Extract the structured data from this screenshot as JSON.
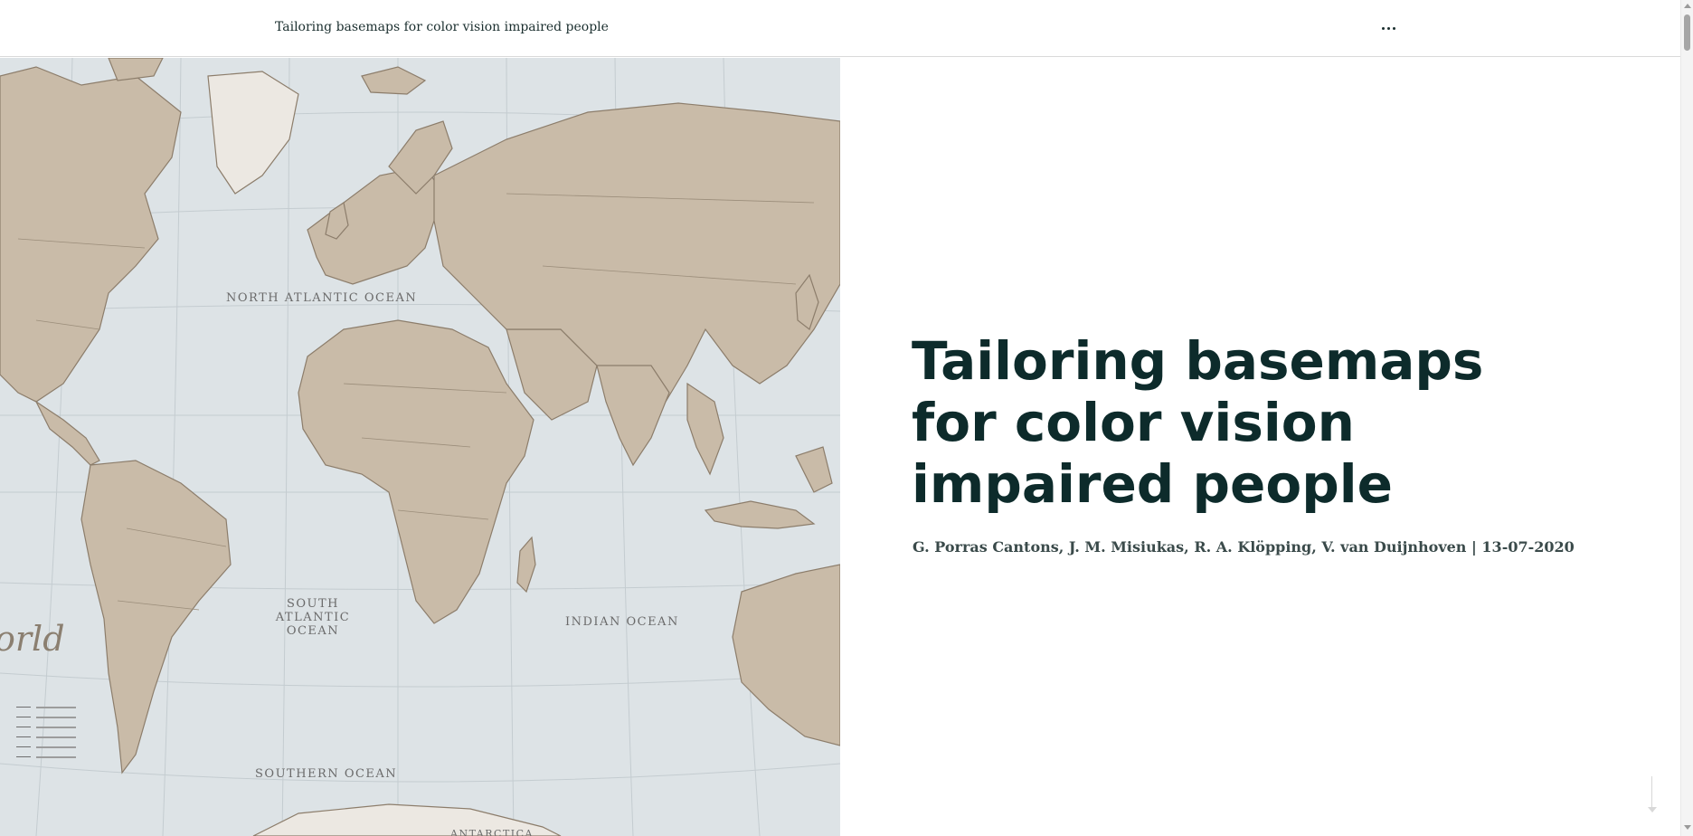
{
  "header": {
    "title": "Tailoring basemaps for color vision impaired people",
    "more_icon": "ellipsis-icon"
  },
  "hero": {
    "title": "Tailoring basemaps for color vision impaired people",
    "authors": "G. Porras Cantons, J. M. Misiukas, R. A. Klöpping, V. van Duijnhoven",
    "separator": "|",
    "date": "13-07-2020"
  },
  "map": {
    "labels": {
      "north_atlantic": "NORTH ATLANTIC OCEAN",
      "south_atlantic": "SOUTH ATLANTIC OCEAN",
      "indian": "INDIAN OCEAN",
      "southern": "SOUTHERN OCEAN",
      "antarctica": "ANTARCTICA",
      "script": "orld"
    },
    "colors": {
      "land": "#c9bba8",
      "ocean": "#dde3e6",
      "border": "#8c7d6b"
    }
  },
  "scroll_hint_icon": "arrow-down-icon"
}
